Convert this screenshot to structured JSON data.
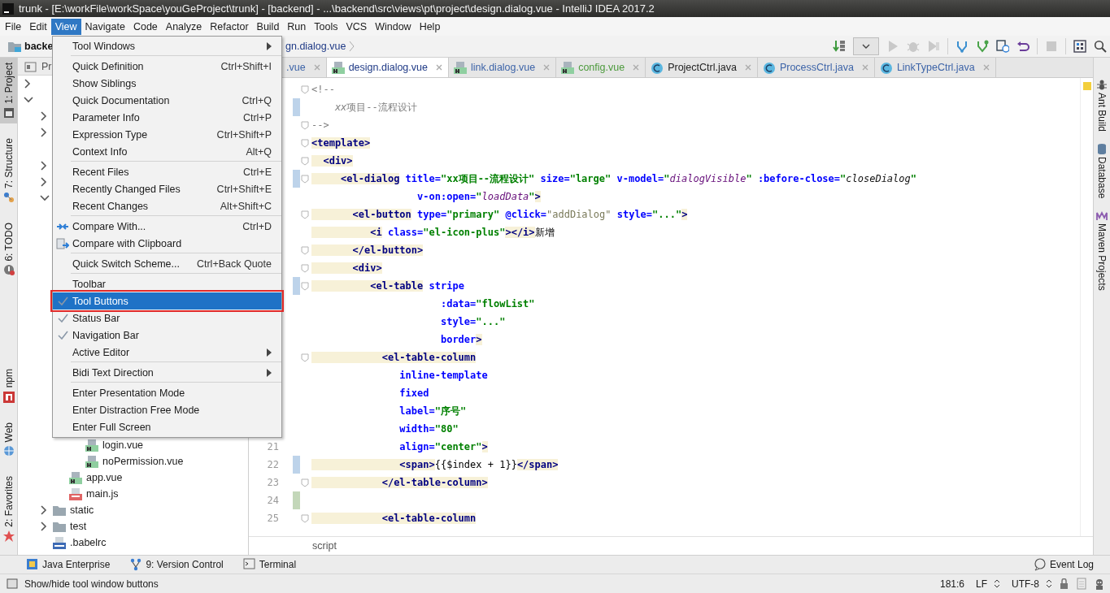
{
  "window": {
    "title": "trunk - [E:\\workFile\\workSpace\\youGeProject\\trunk] - [backend] - ...\\backend\\src\\views\\pt\\project\\design.dialog.vue - IntelliJ IDEA 2017.2"
  },
  "menu_bar": [
    {
      "label": "File",
      "selected": false
    },
    {
      "label": "Edit",
      "selected": false
    },
    {
      "label": "View",
      "selected": true
    },
    {
      "label": "Navigate",
      "selected": false
    },
    {
      "label": "Code",
      "selected": false
    },
    {
      "label": "Analyze",
      "selected": false
    },
    {
      "label": "Refactor",
      "selected": false
    },
    {
      "label": "Build",
      "selected": false
    },
    {
      "label": "Run",
      "selected": false
    },
    {
      "label": "Tools",
      "selected": false
    },
    {
      "label": "VCS",
      "selected": false
    },
    {
      "label": "Window",
      "selected": false
    },
    {
      "label": "Help",
      "selected": false
    }
  ],
  "navigation_bar": {
    "crumbs": [
      "backe",
      "gn.dialog.vue"
    ]
  },
  "left_tool_buttons": {
    "top": [
      {
        "label": "1: Project",
        "selected": true
      },
      {
        "label": "7: Structure",
        "selected": false
      },
      {
        "label": "6: TODO",
        "selected": false
      }
    ],
    "bottom": [
      {
        "label": "npm",
        "selected": false
      },
      {
        "label": "Web",
        "selected": false
      },
      {
        "label": "2: Favorites",
        "selected": false
      }
    ]
  },
  "right_tool_buttons": [
    {
      "label": "Ant Build",
      "kind": "ant"
    },
    {
      "label": "Database",
      "kind": "database"
    },
    {
      "label": "Maven Projects",
      "kind": "maven"
    }
  ],
  "project_panel": {
    "tab": "Pr",
    "tree": [
      {
        "expanded": false
      },
      {
        "expanded": true,
        "children": [
          {
            "expanded": false
          },
          {
            "expanded": false
          },
          {
            "expanded": false
          },
          {
            "expanded": false
          },
          {
            "expanded": true,
            "children": [
              {
                "children": [
                  {
                    "label": "login.vue",
                    "kind": "vue"
                  },
                  {
                    "label": "noPermission.vue",
                    "kind": "vue"
                  }
                ]
              },
              {
                "label": "app.vue",
                "kind": "vue"
              },
              {
                "label": "main.js",
                "kind": "js"
              }
            ]
          },
          {
            "label": "static",
            "kind": "folder",
            "expanded": false
          },
          {
            "label": "test",
            "kind": "folder",
            "expanded": false
          },
          {
            "label": ".babelrc",
            "kind": "json"
          }
        ]
      }
    ]
  },
  "editor_tabs": [
    {
      "label": ".vue",
      "selected": false,
      "color": "#3d64a8"
    },
    {
      "label": "design.dialog.vue",
      "kind": "vue",
      "selected": true,
      "color": "#1f3a86"
    },
    {
      "label": "link.dialog.vue",
      "kind": "vue",
      "selected": false,
      "color": "#3d64a8"
    },
    {
      "label": "config.vue",
      "kind": "vue",
      "selected": false,
      "color": "#4c9a3c"
    },
    {
      "label": "ProjectCtrl.java",
      "kind": "java",
      "selected": false,
      "color": "#222222"
    },
    {
      "label": "ProcessCtrl.java",
      "kind": "java",
      "selected": false,
      "color": "#3d64a8"
    },
    {
      "label": "LinkTypeCtrl.java",
      "kind": "java",
      "selected": false,
      "color": "#3d64a8"
    }
  ],
  "editor": {
    "lines": [
      {
        "fold": true,
        "modified": false,
        "added": false,
        "segments": [
          {
            "kind": "comment",
            "text": "<!--"
          }
        ]
      },
      {
        "fold": false,
        "modified": true,
        "added": false,
        "segments": [
          {
            "kind": "comment-italic",
            "text": "    xx"
          },
          {
            "kind": "comment",
            "text": "项目--流程设计"
          }
        ]
      },
      {
        "fold": true,
        "modified": false,
        "added": false,
        "segments": [
          {
            "kind": "comment",
            "text": "-->"
          }
        ]
      },
      {
        "fold": true,
        "modified": false,
        "added": false,
        "segments": [
          {
            "kind": "tag",
            "text": "<template>"
          }
        ]
      },
      {
        "fold": true,
        "modified": false,
        "added": false,
        "segments": [
          {
            "kind": "tag",
            "text": "  <div>"
          }
        ]
      },
      {
        "fold": true,
        "modified": true,
        "added": false,
        "segments": [
          {
            "kind": "tag",
            "text": "     <el-dialog"
          },
          {
            "kind": "attr",
            "text": " title="
          },
          {
            "kind": "string",
            "text": "\"xx项目--流程设计\""
          },
          {
            "kind": "attr",
            "text": " size="
          },
          {
            "kind": "string",
            "text": "\"large\""
          },
          {
            "kind": "attr",
            "text": " v-model="
          },
          {
            "kind": "string",
            "text": "\""
          },
          {
            "kind": "var",
            "text": "dialogVisible"
          },
          {
            "kind": "string",
            "text": "\""
          },
          {
            "kind": "attr",
            "text": " :before-close="
          },
          {
            "kind": "string",
            "text": "\""
          },
          {
            "kind": "method",
            "text": "closeDialog"
          },
          {
            "kind": "string",
            "text": "\""
          }
        ]
      },
      {
        "fold": false,
        "modified": false,
        "added": false,
        "segments": [
          {
            "kind": "attr",
            "text": "                  v-on:open="
          },
          {
            "kind": "string",
            "text": "\""
          },
          {
            "kind": "var",
            "text": "loadData"
          },
          {
            "kind": "string",
            "text": "\""
          },
          {
            "kind": "tag",
            "text": ">"
          }
        ]
      },
      {
        "fold": true,
        "modified": false,
        "added": false,
        "segments": [
          {
            "kind": "tag",
            "text": "       <el-button"
          },
          {
            "kind": "attr",
            "text": " type="
          },
          {
            "kind": "string",
            "text": "\"primary\""
          },
          {
            "kind": "attr",
            "text": " @click="
          },
          {
            "kind": "value",
            "text": "\"addDialog\""
          },
          {
            "kind": "attr",
            "text": " style="
          },
          {
            "kind": "string",
            "text": "\"...\""
          },
          {
            "kind": "tag",
            "text": ">"
          }
        ]
      },
      {
        "fold": false,
        "modified": false,
        "added": false,
        "segments": [
          {
            "kind": "tag",
            "text": "          <i"
          },
          {
            "kind": "attr",
            "text": " class="
          },
          {
            "kind": "string",
            "text": "\"el-icon-plus\""
          },
          {
            "kind": "tag",
            "text": "></i>"
          },
          {
            "kind": "text",
            "text": "新增"
          }
        ]
      },
      {
        "fold": true,
        "modified": false,
        "added": false,
        "segments": [
          {
            "kind": "tag",
            "text": "       </el-button>"
          }
        ]
      },
      {
        "fold": true,
        "modified": false,
        "added": false,
        "segments": [
          {
            "kind": "tag",
            "text": "       <div>"
          }
        ]
      },
      {
        "fold": true,
        "modified": true,
        "added": false,
        "segments": [
          {
            "kind": "tag",
            "text": "          <el-table"
          },
          {
            "kind": "attr",
            "text": " stripe"
          }
        ]
      },
      {
        "fold": false,
        "modified": false,
        "added": false,
        "segments": [
          {
            "kind": "attr",
            "text": "                      :data="
          },
          {
            "kind": "string",
            "text": "\"flowList\""
          }
        ]
      },
      {
        "fold": false,
        "modified": false,
        "added": false,
        "segments": [
          {
            "kind": "attr",
            "text": "                      style="
          },
          {
            "kind": "string",
            "text": "\"...\""
          }
        ]
      },
      {
        "fold": false,
        "modified": false,
        "added": false,
        "segments": [
          {
            "kind": "attr",
            "text": "                      border"
          },
          {
            "kind": "tag",
            "text": ">"
          }
        ]
      },
      {
        "fold": true,
        "modified": false,
        "added": false,
        "segments": [
          {
            "kind": "tag",
            "text": "            <el-table-column"
          }
        ]
      },
      {
        "fold": false,
        "modified": false,
        "added": false,
        "segments": [
          {
            "kind": "attr",
            "text": "               inline-template"
          }
        ]
      },
      {
        "fold": false,
        "modified": false,
        "added": false,
        "segments": [
          {
            "kind": "attr",
            "text": "               fixed"
          }
        ]
      },
      {
        "fold": false,
        "modified": false,
        "added": false,
        "segments": [
          {
            "kind": "attr",
            "text": "               label="
          },
          {
            "kind": "string",
            "text": "\"序号\""
          }
        ]
      },
      {
        "fold": false,
        "modified": false,
        "added": false,
        "segments": [
          {
            "kind": "attr",
            "text": "               width="
          },
          {
            "kind": "string",
            "text": "\"80\""
          }
        ]
      },
      {
        "number": "21",
        "fold": false,
        "modified": false,
        "added": false,
        "segments": [
          {
            "kind": "attr",
            "text": "               align="
          },
          {
            "kind": "string",
            "text": "\"center\""
          },
          {
            "kind": "tag",
            "text": ">"
          }
        ]
      },
      {
        "number": "22",
        "fold": false,
        "modified": true,
        "added": false,
        "segments": [
          {
            "kind": "tag",
            "text": "               <span>"
          },
          {
            "kind": "text",
            "text": "{{$index + 1}}"
          },
          {
            "kind": "tag",
            "text": "</span>"
          }
        ]
      },
      {
        "number": "23",
        "fold": true,
        "modified": false,
        "added": false,
        "segments": [
          {
            "kind": "tag",
            "text": "            </el-table-column>"
          }
        ]
      },
      {
        "number": "24",
        "fold": false,
        "modified": false,
        "added": true
      },
      {
        "number": "25",
        "fold": true,
        "modified": false,
        "added": false,
        "segments": [
          {
            "kind": "tag",
            "text": "            <el-table-column"
          }
        ]
      }
    ],
    "breadcrumb": "script"
  },
  "view_menu": [
    {
      "kind": "item",
      "label": "Tool Windows",
      "submenu": true,
      "checked": false,
      "selected": false,
      "marked": false
    },
    {
      "kind": "separator"
    },
    {
      "kind": "item",
      "label": "Quick Definition",
      "shortcut": "Ctrl+Shift+I",
      "submenu": false,
      "checked": false,
      "selected": false,
      "marked": false
    },
    {
      "kind": "item",
      "label": "Show Siblings",
      "submenu": false,
      "checked": false,
      "selected": false,
      "marked": false
    },
    {
      "kind": "item",
      "label": "Quick Documentation",
      "shortcut": "Ctrl+Q",
      "submenu": false,
      "checked": false,
      "selected": false,
      "marked": false
    },
    {
      "kind": "item",
      "label": "Parameter Info",
      "shortcut": "Ctrl+P",
      "submenu": false,
      "checked": false,
      "selected": false,
      "marked": false
    },
    {
      "kind": "item",
      "label": "Expression Type",
      "shortcut": "Ctrl+Shift+P",
      "submenu": false,
      "checked": false,
      "selected": false,
      "marked": false
    },
    {
      "kind": "item",
      "label": "Context Info",
      "shortcut": "Alt+Q",
      "submenu": false,
      "checked": false,
      "selected": false,
      "marked": false
    },
    {
      "kind": "separator"
    },
    {
      "kind": "item",
      "label": "Recent Files",
      "shortcut": "Ctrl+E",
      "submenu": false,
      "checked": false,
      "selected": false,
      "marked": false
    },
    {
      "kind": "item",
      "label": "Recently Changed Files",
      "shortcut": "Ctrl+Shift+E",
      "submenu": false,
      "checked": false,
      "selected": false,
      "marked": false
    },
    {
      "kind": "item",
      "label": "Recent Changes",
      "shortcut": "Alt+Shift+C",
      "submenu": false,
      "checked": false,
      "selected": false,
      "marked": false
    },
    {
      "kind": "separator"
    },
    {
      "kind": "compare",
      "label": "Compare With...",
      "shortcut": "Ctrl+D",
      "submenu": false,
      "checked": false,
      "selected": false,
      "marked": false
    },
    {
      "kind": "clipboard",
      "label": "Compare with Clipboard",
      "submenu": false,
      "checked": false,
      "selected": false,
      "marked": false
    },
    {
      "kind": "separator"
    },
    {
      "kind": "item",
      "label": "Quick Switch Scheme...",
      "shortcut": "Ctrl+Back Quote",
      "submenu": false,
      "checked": false,
      "selected": false,
      "marked": false
    },
    {
      "kind": "separator"
    },
    {
      "kind": "item",
      "label": "Toolbar",
      "submenu": false,
      "checked": false,
      "selected": false,
      "marked": false
    },
    {
      "kind": "item",
      "label": "Tool Buttons",
      "submenu": false,
      "checked": true,
      "selected": true,
      "marked": true
    },
    {
      "kind": "item",
      "label": "Status Bar",
      "submenu": false,
      "checked": true,
      "selected": false,
      "marked": false
    },
    {
      "kind": "item",
      "label": "Navigation Bar",
      "submenu": false,
      "checked": true,
      "selected": false,
      "marked": false
    },
    {
      "kind": "item",
      "label": "Active Editor",
      "submenu": true,
      "checked": false,
      "selected": false,
      "marked": false
    },
    {
      "kind": "separator"
    },
    {
      "kind": "item",
      "label": "Bidi Text Direction",
      "submenu": true,
      "checked": false,
      "selected": false,
      "marked": false
    },
    {
      "kind": "separator"
    },
    {
      "kind": "item",
      "label": "Enter Presentation Mode",
      "submenu": false,
      "checked": false,
      "selected": false,
      "marked": false
    },
    {
      "kind": "item",
      "label": "Enter Distraction Free Mode",
      "submenu": false,
      "checked": false,
      "selected": false,
      "marked": false
    },
    {
      "kind": "item",
      "label": "Enter Full Screen",
      "submenu": false,
      "checked": false,
      "selected": false,
      "marked": false
    }
  ],
  "bottom_tool_buttons": {
    "left": [
      {
        "label": "Java Enterprise"
      },
      {
        "label": "9: Version Control"
      },
      {
        "label": "Terminal"
      }
    ],
    "right": [
      {
        "label": "Event Log"
      }
    ]
  },
  "status_bar": {
    "message": "Show/hide tool window buttons",
    "position": "181:6",
    "line_separator": "LF",
    "encoding": "UTF-8"
  }
}
